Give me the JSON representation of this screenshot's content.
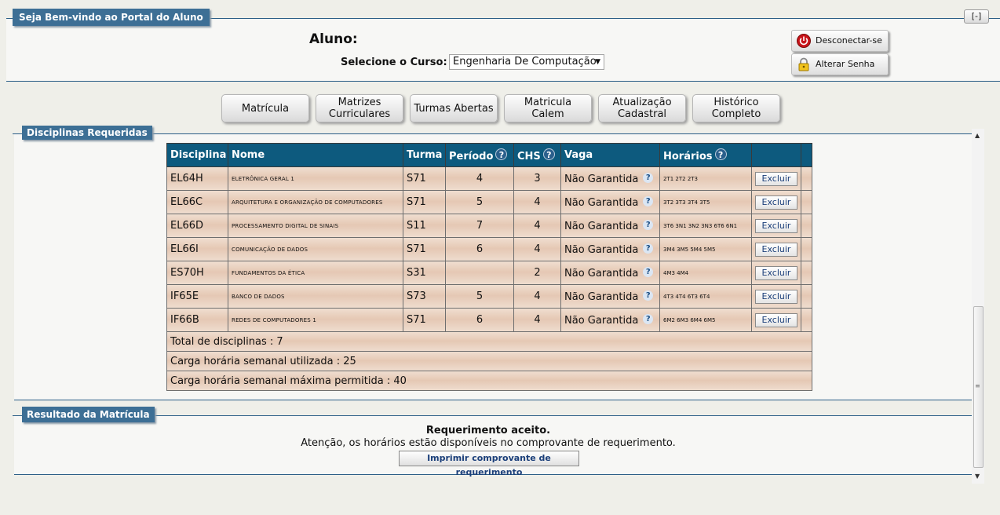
{
  "header": {
    "title": "Seja Bem-vindo ao Portal do Aluno",
    "collapse_label": "[-]",
    "aluno_label": "Aluno:",
    "curso_label": "Selecione o Curso:",
    "curso_value": "Engenharia De Computação",
    "disconnect_label": "Desconectar-se",
    "change_password_label": "Alterar Senha"
  },
  "nav": {
    "buttons": [
      {
        "label": "Matrícula"
      },
      {
        "label": "Matrizes Curriculares"
      },
      {
        "label": "Turmas Abertas"
      },
      {
        "label": "Matricula Calem"
      },
      {
        "label": "Atualização Cadastral"
      },
      {
        "label": "Histórico Completo"
      }
    ]
  },
  "disciplinas": {
    "section_title": "Disciplinas Requeridas",
    "columns": [
      "Disciplina",
      "Nome",
      "Turma",
      "Período",
      "CHS",
      "Vaga",
      "Horários"
    ],
    "help_glyph": "?",
    "excluir_label": "Excluir",
    "rows": [
      {
        "codigo": "EL64H",
        "nome": "ELETRÔNICA GERAL 1",
        "turma": "S71",
        "periodo": "4",
        "chs": "3",
        "vaga": "Não Garantida",
        "horarios": "2T1 2T2 2T3"
      },
      {
        "codigo": "EL66C",
        "nome": "ARQUITETURA E ORGANIZAÇÃO DE COMPUTADORES",
        "turma": "S71",
        "periodo": "5",
        "chs": "4",
        "vaga": "Não Garantida",
        "horarios": "3T2 3T3 3T4 3T5"
      },
      {
        "codigo": "EL66D",
        "nome": "PROCESSAMENTO DIGITAL DE SINAIS",
        "turma": "S11",
        "periodo": "7",
        "chs": "4",
        "vaga": "Não Garantida",
        "horarios": "3T6 3N1 3N2 3N3 6T6 6N1"
      },
      {
        "codigo": "EL66I",
        "nome": "COMUNICAÇÃO DE DADOS",
        "turma": "S71",
        "periodo": "6",
        "chs": "4",
        "vaga": "Não Garantida",
        "horarios": "3M4 3M5 5M4 5M5"
      },
      {
        "codigo": "ES70H",
        "nome": "FUNDAMENTOS DA ÉTICA",
        "turma": "S31",
        "periodo": "",
        "chs": "2",
        "vaga": "Não Garantida",
        "horarios": "4M3 4M4"
      },
      {
        "codigo": "IF65E",
        "nome": "BANCO DE DADOS",
        "turma": "S73",
        "periodo": "5",
        "chs": "4",
        "vaga": "Não Garantida",
        "horarios": "4T3 4T4 6T3 6T4"
      },
      {
        "codigo": "IF66B",
        "nome": "REDES DE COMPUTADORES 1",
        "turma": "S71",
        "periodo": "6",
        "chs": "4",
        "vaga": "Não Garantida",
        "horarios": "6M2 6M3 6M4 6M5"
      }
    ],
    "summary": {
      "total": "Total de disciplinas : 7",
      "carga_utilizada": "Carga horária semanal utilizada : 25",
      "carga_maxima": "Carga horária semanal máxima permitida : 40"
    }
  },
  "resultado": {
    "section_title": "Resultado da Matrícula",
    "status": "Requerimento aceito.",
    "message": "Atenção, os horários estão disponíveis no comprovante de requerimento.",
    "print_label": "Imprimir comprovante de requerimento"
  }
}
